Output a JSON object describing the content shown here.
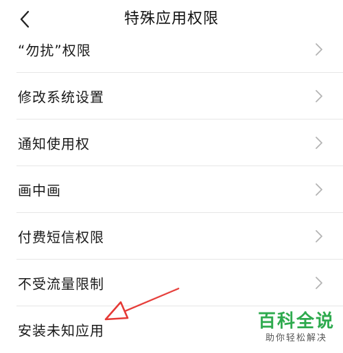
{
  "header": {
    "title": "特殊应用权限",
    "back_icon": "back-chevron-icon"
  },
  "list": {
    "items": [
      {
        "label": "“勿扰”权限"
      },
      {
        "label": "修改系统设置"
      },
      {
        "label": "通知使用权"
      },
      {
        "label": "画中画"
      },
      {
        "label": "付费短信权限"
      },
      {
        "label": "不受流量限制"
      },
      {
        "label": "安装未知应用"
      }
    ],
    "chevron_icon": "chevron-right-icon"
  },
  "annotation": {
    "arrow_color": "#e53935"
  },
  "watermark": {
    "title": "百科全说",
    "subtitle": "助你轻松解决",
    "title_color": "#2eaa4e"
  }
}
